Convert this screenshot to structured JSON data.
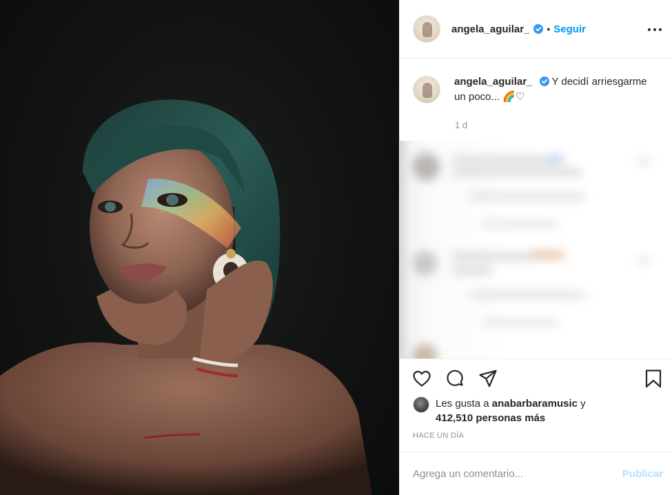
{
  "colors": {
    "accent": "#0095f6",
    "publish_disabled": "#b2dffc",
    "secondary_text": "#8e8e8e",
    "text": "#262626",
    "divider": "#efefef"
  },
  "photo": {
    "icon": "post-photo"
  },
  "header": {
    "username": "angela_aguilar_",
    "verified_icon": "verified-badge-icon",
    "separator": "•",
    "follow_label": "Seguir",
    "more_icon": "more-options-icon"
  },
  "caption": {
    "username": "angela_aguilar_",
    "text": "Y decidí arriesgarme un poco... 🌈♡",
    "time": "1 d"
  },
  "actions": {
    "like_icon": "heart-icon",
    "comment_icon": "comment-icon",
    "share_icon": "send-icon",
    "save_icon": "bookmark-icon"
  },
  "likes": {
    "prefix": "Les gusta a ",
    "user": "anabarbaramusic",
    "middle": " y",
    "count": "412,510 personas más"
  },
  "date_label": "HACE UN DÍA",
  "comment": {
    "placeholder": "Agrega un comentario...",
    "publish_label": "Publicar"
  }
}
